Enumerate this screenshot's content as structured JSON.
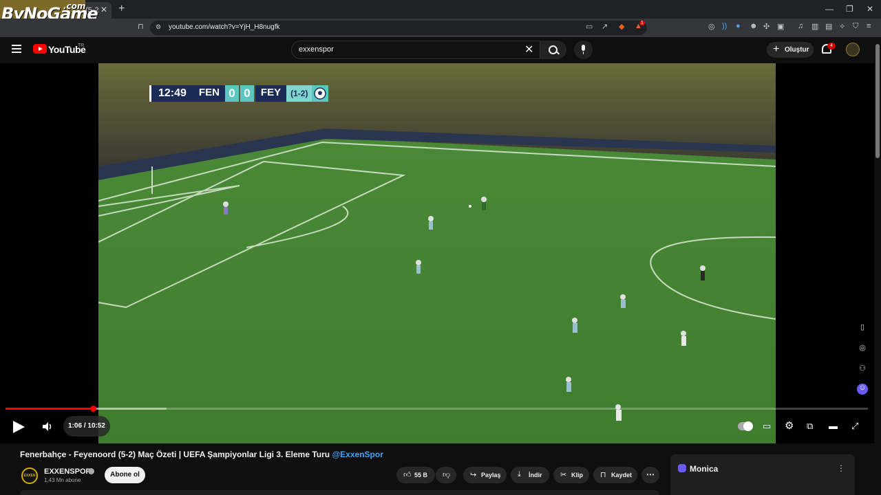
{
  "browser": {
    "tab_title": "(5-2",
    "url": "youtube.com/watch?v=YjH_H8nugfk",
    "watermark_main": "ByNoGame",
    "watermark_suffix": ".com",
    "extension_badge": "1"
  },
  "header": {
    "logo_text": "YouTube",
    "logo_region": "TR",
    "search_value": "exxenspor",
    "create_label": "Oluştur",
    "notification_count": "4"
  },
  "video": {
    "scorebug": {
      "clock": "12:49",
      "home": "FEN",
      "home_score": "0",
      "away_score": "0",
      "away": "FEY",
      "aggregate": "(1-2)"
    },
    "current_time": "1:06",
    "duration": "10:52",
    "time_display": "1:06 / 10:52",
    "progress_fraction": 0.101,
    "buffered_fraction": 0.187
  },
  "meta": {
    "title": "Fenerbahçe - Feyenoord (5-2) Maç Özeti | UEFA Şampiyonlar Ligi 3. Eleme Turu",
    "title_mention": "@ExxenSpor",
    "channel_name": "EXXENSPOR",
    "channel_logo_text": "EXXEN",
    "subscribers": "1,43 Mn abone",
    "subscribe_label": "Abone ol",
    "likes": "55 B",
    "share_label": "Paylaş",
    "download_label": "İndir",
    "clip_label": "Klip",
    "save_label": "Kaydet"
  },
  "sidepanel": {
    "title": "Monica"
  },
  "colors": {
    "accent_red": "#ff0000",
    "link_blue": "#3ea6ff",
    "background": "#0f0f0f"
  }
}
